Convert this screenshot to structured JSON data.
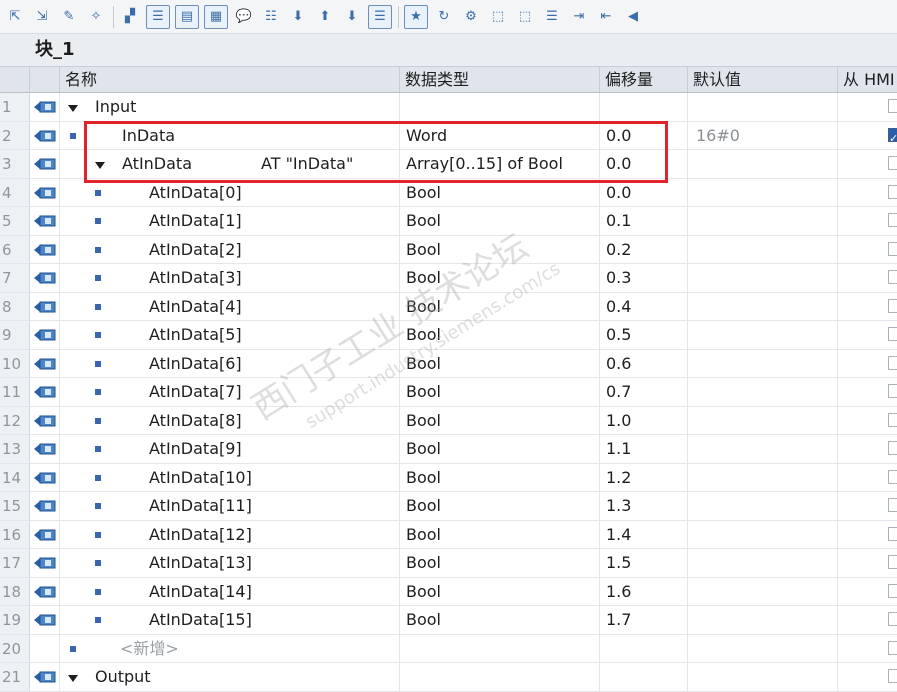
{
  "toolbar": {
    "icons": [
      "insert-row-icon",
      "insert-row-below-icon",
      "delete-row-icon",
      "clear-icon",
      "zoom-icon",
      "collapse-all-icon",
      "expand-all-icon",
      "show-comment-icon",
      "toggle-comment-icon",
      "export-icon",
      "import-icon",
      "download-icon",
      "list-view-icon",
      "favorites-icon",
      "call-icon",
      "monitor-icon",
      "retain-icon",
      "snapshot-icon",
      "setpoint-icon",
      "copy-icon",
      "indent-icon",
      "outdent-icon",
      "back-icon"
    ]
  },
  "block": {
    "title": "块_1"
  },
  "columns": {
    "name": "名称",
    "type": "数据类型",
    "offset": "偏移量",
    "default": "默认值",
    "hmi": "从 HMI"
  },
  "rows": [
    {
      "num": "1",
      "icon": true,
      "level": 0,
      "expand": true,
      "bullet": false,
      "name": "Input",
      "at": "",
      "type": "",
      "offset": "",
      "default": "",
      "hmi": "empty"
    },
    {
      "num": "2",
      "icon": true,
      "level": 1,
      "expand": false,
      "bullet": true,
      "name": "InData",
      "at": "",
      "type": "Word",
      "offset": "0.0",
      "default": "16#0",
      "hmi": "checked"
    },
    {
      "num": "3",
      "icon": true,
      "level": 1,
      "expand": true,
      "bullet": false,
      "name": "AtInData",
      "at": "AT \"InData\"",
      "type": "Array[0..15] of Bool",
      "offset": "0.0",
      "default": "",
      "hmi": "empty"
    },
    {
      "num": "4",
      "icon": true,
      "level": 2,
      "expand": false,
      "bullet": true,
      "name": "AtInData[0]",
      "at": "",
      "type": "Bool",
      "offset": "0.0",
      "default": "",
      "hmi": "empty"
    },
    {
      "num": "5",
      "icon": true,
      "level": 2,
      "expand": false,
      "bullet": true,
      "name": "AtInData[1]",
      "at": "",
      "type": "Bool",
      "offset": "0.1",
      "default": "",
      "hmi": "empty"
    },
    {
      "num": "6",
      "icon": true,
      "level": 2,
      "expand": false,
      "bullet": true,
      "name": "AtInData[2]",
      "at": "",
      "type": "Bool",
      "offset": "0.2",
      "default": "",
      "hmi": "empty"
    },
    {
      "num": "7",
      "icon": true,
      "level": 2,
      "expand": false,
      "bullet": true,
      "name": "AtInData[3]",
      "at": "",
      "type": "Bool",
      "offset": "0.3",
      "default": "",
      "hmi": "empty"
    },
    {
      "num": "8",
      "icon": true,
      "level": 2,
      "expand": false,
      "bullet": true,
      "name": "AtInData[4]",
      "at": "",
      "type": "Bool",
      "offset": "0.4",
      "default": "",
      "hmi": "empty"
    },
    {
      "num": "9",
      "icon": true,
      "level": 2,
      "expand": false,
      "bullet": true,
      "name": "AtInData[5]",
      "at": "",
      "type": "Bool",
      "offset": "0.5",
      "default": "",
      "hmi": "empty"
    },
    {
      "num": "10",
      "icon": true,
      "level": 2,
      "expand": false,
      "bullet": true,
      "name": "AtInData[6]",
      "at": "",
      "type": "Bool",
      "offset": "0.6",
      "default": "",
      "hmi": "empty"
    },
    {
      "num": "11",
      "icon": true,
      "level": 2,
      "expand": false,
      "bullet": true,
      "name": "AtInData[7]",
      "at": "",
      "type": "Bool",
      "offset": "0.7",
      "default": "",
      "hmi": "empty"
    },
    {
      "num": "12",
      "icon": true,
      "level": 2,
      "expand": false,
      "bullet": true,
      "name": "AtInData[8]",
      "at": "",
      "type": "Bool",
      "offset": "1.0",
      "default": "",
      "hmi": "empty"
    },
    {
      "num": "13",
      "icon": true,
      "level": 2,
      "expand": false,
      "bullet": true,
      "name": "AtInData[9]",
      "at": "",
      "type": "Bool",
      "offset": "1.1",
      "default": "",
      "hmi": "empty"
    },
    {
      "num": "14",
      "icon": true,
      "level": 2,
      "expand": false,
      "bullet": true,
      "name": "AtInData[10]",
      "at": "",
      "type": "Bool",
      "offset": "1.2",
      "default": "",
      "hmi": "empty"
    },
    {
      "num": "15",
      "icon": true,
      "level": 2,
      "expand": false,
      "bullet": true,
      "name": "AtInData[11]",
      "at": "",
      "type": "Bool",
      "offset": "1.3",
      "default": "",
      "hmi": "empty"
    },
    {
      "num": "16",
      "icon": true,
      "level": 2,
      "expand": false,
      "bullet": true,
      "name": "AtInData[12]",
      "at": "",
      "type": "Bool",
      "offset": "1.4",
      "default": "",
      "hmi": "empty"
    },
    {
      "num": "17",
      "icon": true,
      "level": 2,
      "expand": false,
      "bullet": true,
      "name": "AtInData[13]",
      "at": "",
      "type": "Bool",
      "offset": "1.5",
      "default": "",
      "hmi": "empty"
    },
    {
      "num": "18",
      "icon": true,
      "level": 2,
      "expand": false,
      "bullet": true,
      "name": "AtInData[14]",
      "at": "",
      "type": "Bool",
      "offset": "1.6",
      "default": "",
      "hmi": "empty"
    },
    {
      "num": "19",
      "icon": true,
      "level": 2,
      "expand": false,
      "bullet": true,
      "name": "AtInData[15]",
      "at": "",
      "type": "Bool",
      "offset": "1.7",
      "default": "",
      "hmi": "empty"
    },
    {
      "num": "20",
      "icon": false,
      "level": 0,
      "expand": false,
      "bullet": true,
      "name": "<新增>",
      "at": "",
      "type": "",
      "offset": "",
      "default": "",
      "hmi": "empty",
      "placeholder": true
    },
    {
      "num": "21",
      "icon": true,
      "level": 0,
      "expand": true,
      "bullet": false,
      "name": "Output",
      "at": "",
      "type": "",
      "offset": "",
      "default": "",
      "hmi": "empty"
    }
  ],
  "watermark": {
    "line1": "西门子工业 技术论坛",
    "line2": "support.industry.siemens.com/cs"
  },
  "colors": {
    "accent": "#2b5ea8",
    "highlight": "#e0242a",
    "header": "#dfe5ea"
  }
}
